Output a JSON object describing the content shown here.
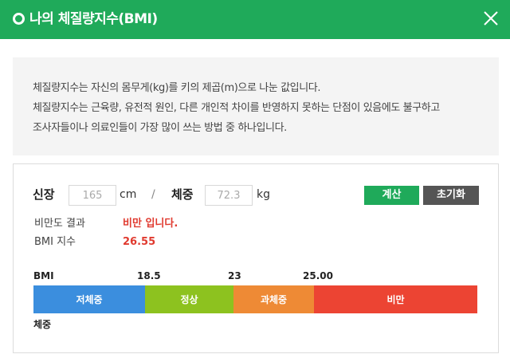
{
  "header": {
    "title": "나의 체질량지수(BMI)"
  },
  "description": {
    "lines": [
      "체질량지수는 자신의 몸무게(kg)를 키의 제곱(m)으로 나눈 값입니다.",
      "체질량지수는 근육량, 유전적 원인, 다른 개인적 차이를 반영하지 못하는 단점이 있음에도 불구하고",
      "조사자들이나 의료인들이 가장 많이 쓰는 방법 중 하나입니다."
    ]
  },
  "form": {
    "height_label": "신장",
    "height_value": "165",
    "height_unit": "cm",
    "separator": "/",
    "weight_label": "체중",
    "weight_value": "72.3",
    "weight_unit": "kg",
    "calc_button": "계산",
    "reset_button": "초기화"
  },
  "result": {
    "status_label": "비만도 결과",
    "status_value": "비만 입니다.",
    "bmi_label": "BMI 지수",
    "bmi_value": "26.55"
  },
  "scale": {
    "bmi_label": "BMI",
    "thresholds": [
      "18.5",
      "23",
      "25.00"
    ],
    "segments": [
      "저체중",
      "정상",
      "과체중",
      "비만"
    ],
    "weight_label": "체중"
  },
  "colors": {
    "accent": "#1faa5a",
    "reset": "#555555",
    "result": "#e03a2f",
    "underweight": "#3b8ede",
    "normal": "#8dc21f",
    "overweight": "#ee8a35",
    "obese": "#ec4433"
  },
  "icons": {
    "header": "circle-icon",
    "close": "close-icon"
  }
}
